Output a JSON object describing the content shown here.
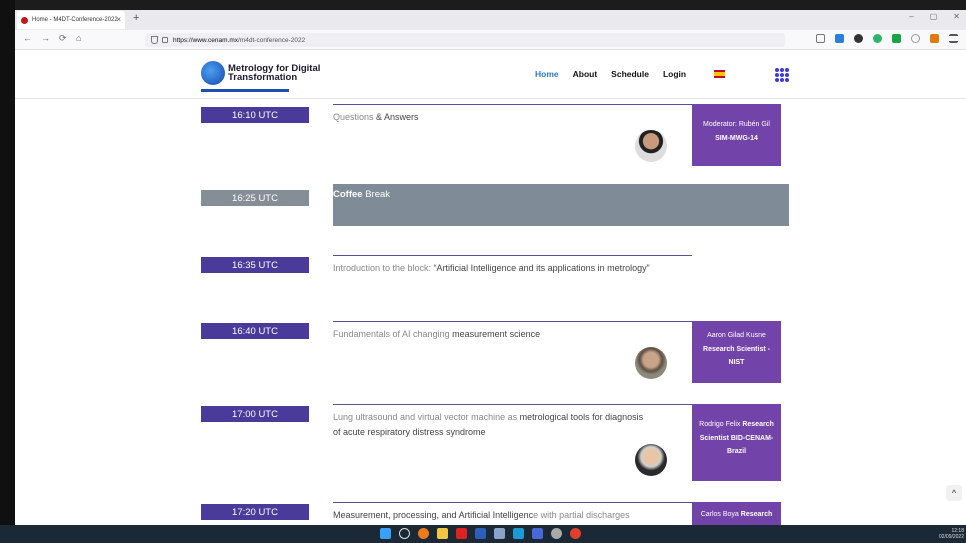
{
  "browser": {
    "tab_title": "Home - M4DT-Conference-2022",
    "tab_close": "×",
    "new_tab": "+",
    "url_host": "https://www.cenam.mx",
    "url_path": "/m4dt-conference-2022",
    "back": "←",
    "forward": "→",
    "reload": "⟳",
    "home": "⌂",
    "minimize": "–",
    "maximize": "▢",
    "close": "✕"
  },
  "site": {
    "logo_line1": "Metrology for Digital",
    "logo_line2": "Transformation",
    "menu": [
      "Home",
      "About",
      "Schedule",
      "Login"
    ]
  },
  "schedule": [
    {
      "time": "16:10 UTC",
      "title_light": "Questions ",
      "title_dark": "& Answers",
      "moderator_light": "Moderator: Rubén Gil",
      "moderator_bold": "SIM-MWG-14"
    },
    {
      "time": "16:25 UTC",
      "title_bold": "Coffee",
      "title_light": " Break"
    },
    {
      "time": "16:35 UTC",
      "title_light": "Introduction to the block: ",
      "title_dark": "“Artificial Intelligence and its applications in metrology”"
    },
    {
      "time": "16:40 UTC",
      "title_light": "Fundamentals of AI changing ",
      "title_dark": "measurement science",
      "speaker_light": "Aaron Gilad Kusne",
      "speaker_bold": "Research Scientist - NIST"
    },
    {
      "time": "17:00 UTC",
      "title_light": "Lung ultrasound and virtual vector machine as ",
      "title_dark": "metrological tools for diagnosis of acute respiratory distress syndrome",
      "speaker_light": "Rodrigo Felix ",
      "speaker_bold": "Research Scientist BID-CENAM- Brazil"
    },
    {
      "time": "17:20 UTC",
      "title_dark": "Measurement, processing, and Artificial Intelligenc",
      "title_light": "e with partial discharges",
      "speaker_light": "Carlos Boya ",
      "speaker_bold": "Research"
    }
  ],
  "scroll_top": "^",
  "taskbar": {
    "time": "12:18",
    "date": "02/09/2022"
  },
  "colors": {
    "time_box": "#4a3a9a",
    "speaker_box": "#7243a8",
    "coffee": "#7f8b96",
    "active_link": "#2a78d6"
  }
}
